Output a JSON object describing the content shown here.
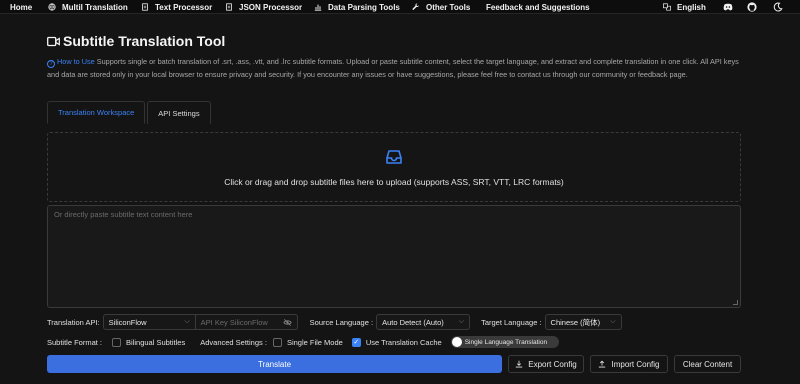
{
  "nav": {
    "home": "Home",
    "multi_translation": "Multil Translation",
    "text_processor": "Text Processor",
    "json_processor": "JSON Processor",
    "data_parsing_tools": "Data Parsing Tools",
    "other_tools": "Other Tools",
    "feedback": "Feedback and Suggestions",
    "language": "English"
  },
  "page": {
    "title": "Subtitle Translation Tool",
    "how_to_use": "How to Use",
    "description": "Supports single or batch translation of .srt, .ass, .vtt, and .lrc subtitle formats. Upload or paste subtitle content, select the target language, and extract and complete translation in one click. All API keys and data are stored only in your local browser to ensure privacy and security. If you encounter any issues or have suggestions, please feel free to contact us through our community or feedback page."
  },
  "tabs": [
    {
      "label": "Translation Workspace",
      "active": true
    },
    {
      "label": "API Settings",
      "active": false
    }
  ],
  "upload": {
    "text": "Click or drag and drop subtitle files here to upload (supports ASS, SRT, VTT, LRC formats)"
  },
  "paste": {
    "placeholder": "Or directly paste subtitle text content here",
    "value": ""
  },
  "options": {
    "translation_api_label": "Translation API:",
    "translation_api_value": "SiliconFlow",
    "api_key_placeholder": "API Key SiliconFlow",
    "source_language_label": "Source Language :",
    "source_language_value": "Auto Detect (Auto)",
    "target_language_label": "Target Language :",
    "target_language_value": "Chinese (简体)",
    "subtitle_format_label": "Subtitle Format :",
    "bilingual_subtitles": {
      "label": "Bilingual Subtitles",
      "checked": false
    },
    "advanced_settings_label": "Advanced Settings :",
    "single_file_mode": {
      "label": "Single File Mode",
      "checked": false
    },
    "use_translation_cache": {
      "label": "Use Translation Cache",
      "checked": true
    },
    "single_language_translation": {
      "label": "Single Language Translation",
      "on": false
    }
  },
  "actions": {
    "translate": "Translate",
    "export_config": "Export Config",
    "import_config": "Import Config",
    "clear_content": "Clear Content"
  },
  "colors": {
    "accent": "#3b82f6",
    "primary_button": "#3b6fe0",
    "background": "#141414"
  }
}
